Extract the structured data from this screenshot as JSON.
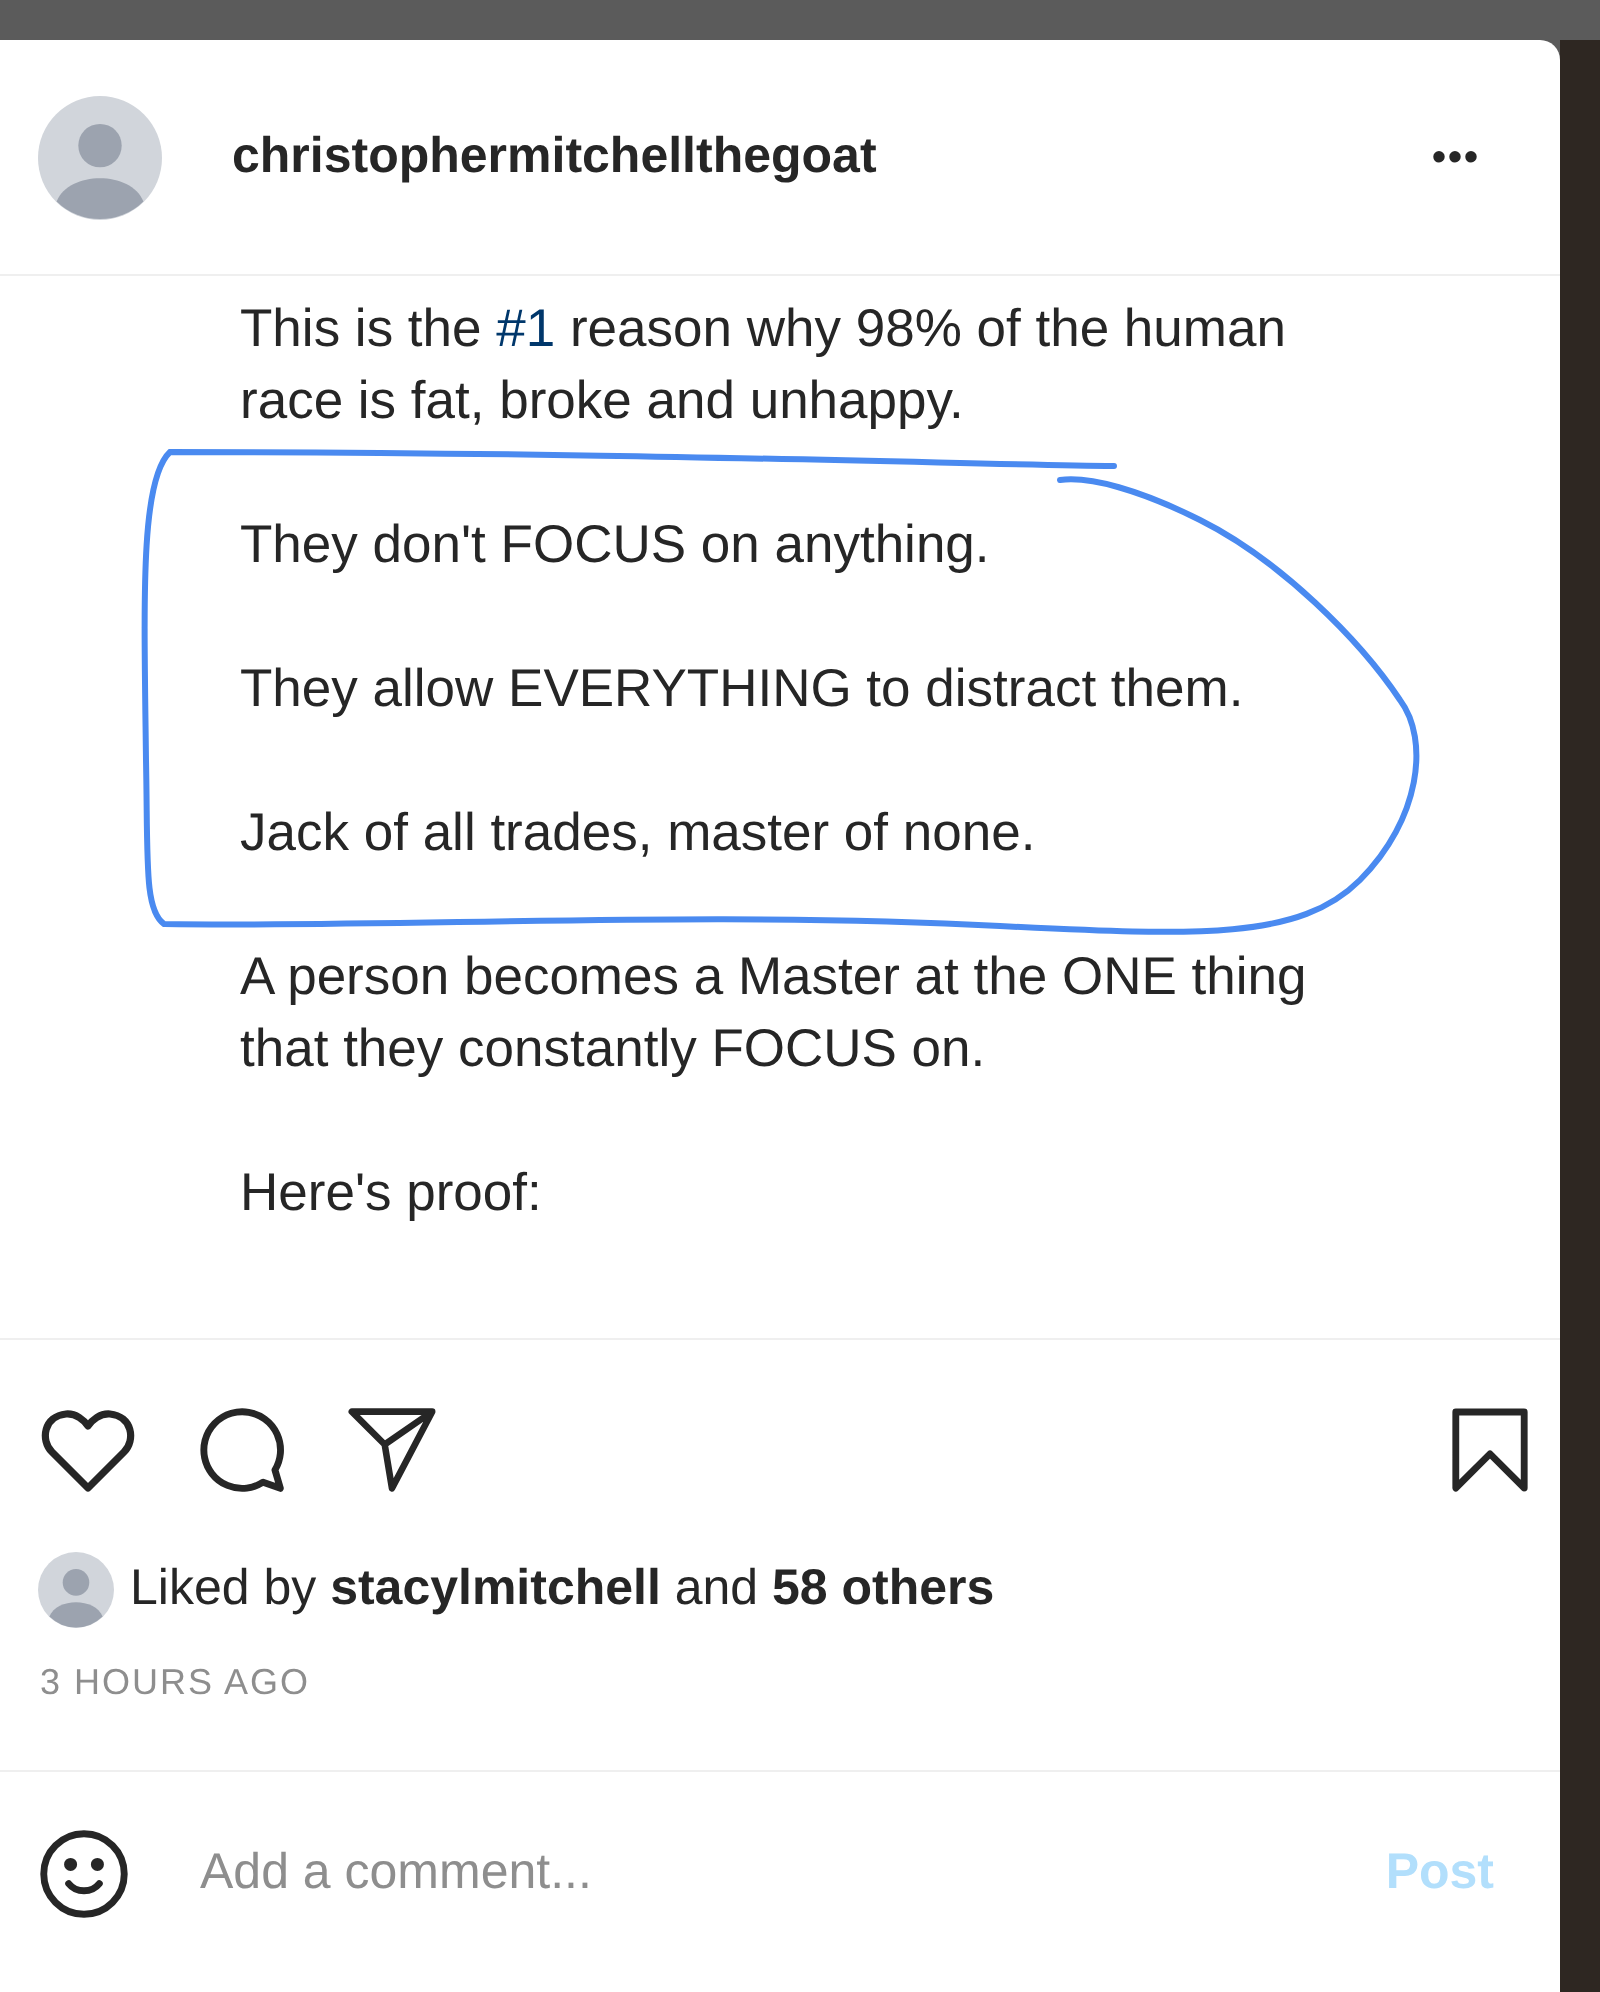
{
  "post": {
    "username": "christophermitchellthegoat",
    "more_label": "•••",
    "caption": [
      {
        "parts": [
          {
            "kind": "text",
            "text": "This is the "
          },
          {
            "kind": "hashtag",
            "text": "#1"
          },
          {
            "kind": "text",
            "text": " reason why 98% of the human race is fat, broke and unhappy."
          }
        ]
      },
      {
        "parts": [
          {
            "kind": "text",
            "text": "They don't FOCUS on anything."
          }
        ]
      },
      {
        "parts": [
          {
            "kind": "text",
            "text": "They allow EVERYTHING to distract them."
          }
        ]
      },
      {
        "parts": [
          {
            "kind": "text",
            "text": "Jack of all trades, master of none."
          }
        ]
      },
      {
        "parts": [
          {
            "kind": "text",
            "text": "A person becomes a Master at the ONE thing that they constantly FOCUS on."
          }
        ]
      },
      {
        "parts": [
          {
            "kind": "text",
            "text": "Here's proof:"
          }
        ]
      }
    ],
    "likes": "Liked by **stacylmitchell** and **58 others**",
    "time": "3 HOURS AGO",
    "comment": {
      "placeholder": "Add a comment..."
    },
    "post_button": {
      "label": "Post",
      "disabled": true
    }
  }
}
